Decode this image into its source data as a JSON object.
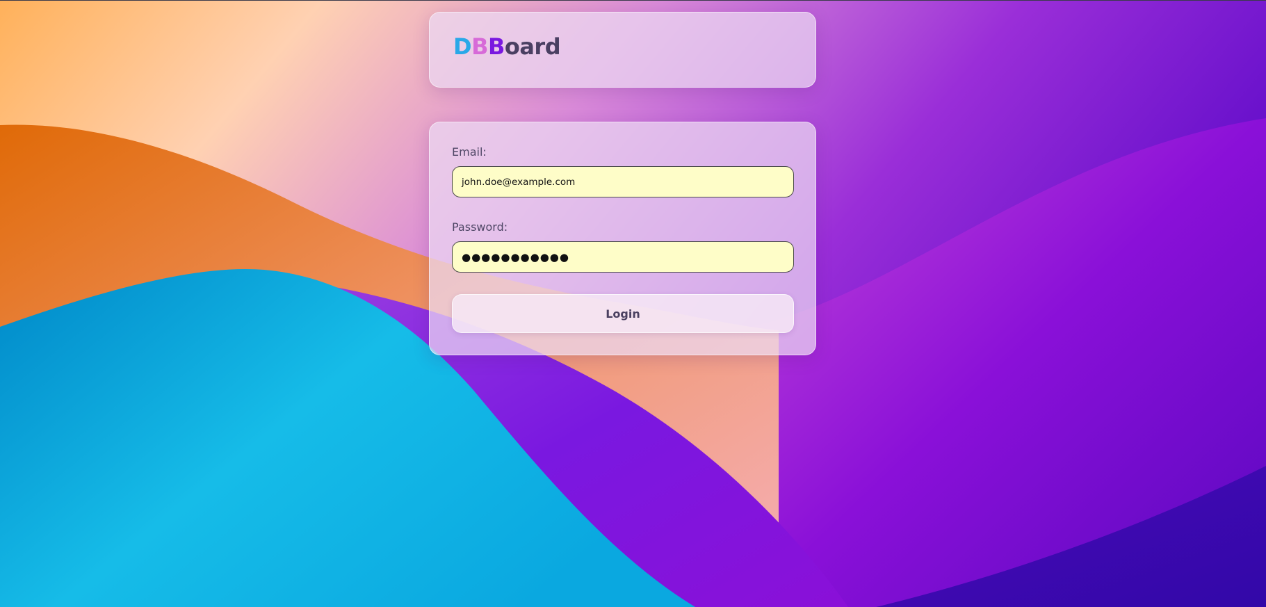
{
  "brand": {
    "logo_parts": [
      "D",
      "B",
      "B",
      "oard"
    ],
    "colors": {
      "d1": "#2aa8e8",
      "d2": "#d76ad8",
      "b1": "#7a18e0",
      "rest": "#4a3f62"
    }
  },
  "login_form": {
    "email_label": "Email:",
    "email_value": "john.doe@example.com",
    "password_label": "Password:",
    "password_value": "●●●●●●●●●●●",
    "submit_label": "Login"
  },
  "theme": {
    "input_bg": "#fefdc8",
    "card_bg": "rgba(235,218,242,0.72)"
  }
}
